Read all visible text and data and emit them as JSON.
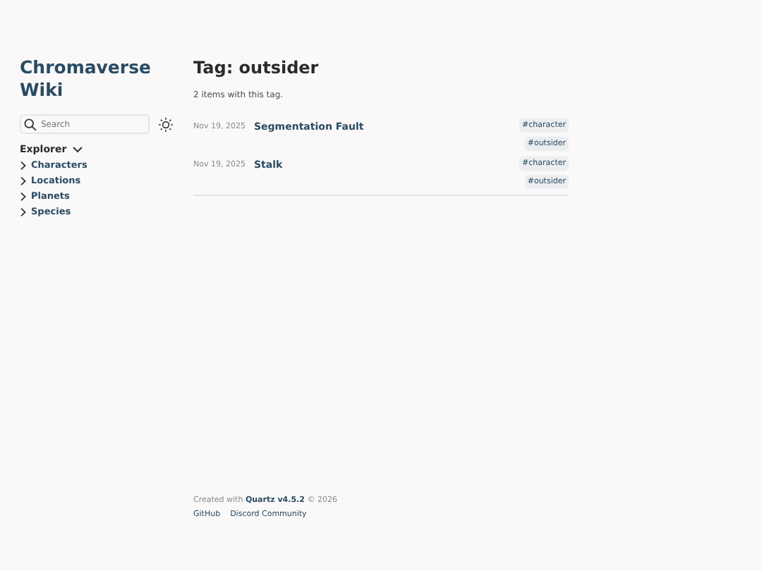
{
  "site_title": "Chromaverse Wiki",
  "search": {
    "placeholder": "Search"
  },
  "explorer": {
    "title": "Explorer",
    "expanded": true,
    "items": [
      {
        "label": "Characters",
        "expanded": false
      },
      {
        "label": "Locations",
        "expanded": false
      },
      {
        "label": "Planets",
        "expanded": false
      },
      {
        "label": "Species",
        "expanded": false
      }
    ]
  },
  "page_title": "Tag: outsider",
  "summary": "2 items with this tag.",
  "items": [
    {
      "date": "Nov 19, 2025",
      "title": "Segmentation Fault",
      "tags": [
        "#character",
        "#outsider"
      ]
    },
    {
      "date": "Nov 19, 2025",
      "title": "Stalk",
      "tags": [
        "#character",
        "#outsider"
      ]
    }
  ],
  "footer": {
    "prefix": "Created with",
    "link": "Quartz v4.5.2",
    "suffix": "© 2026",
    "links": [
      "GitHub",
      "Discord Community"
    ]
  }
}
